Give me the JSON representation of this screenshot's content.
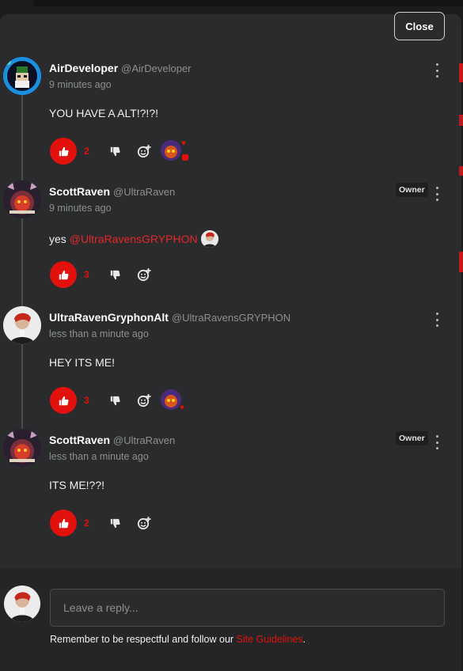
{
  "dialog": {
    "close_label": "Close"
  },
  "comments": [
    {
      "author": "AirDeveloper",
      "handle": "@AirDeveloper",
      "time": "9 minutes ago",
      "text": "YOU HAVE A ALT!?!?!",
      "likes": "2",
      "badge": null,
      "mention": null,
      "reactions": [
        "heart",
        "red-square"
      ]
    },
    {
      "author": "ScottRaven",
      "handle": "@UltraRaven",
      "time": "9 minutes ago",
      "text": "yes",
      "mention": "@UltraRavensGRYPHON",
      "likes": "3",
      "badge": "Owner"
    },
    {
      "author": "UltraRavenGryphonAlt",
      "handle": "@UltraRavensGRYPHON",
      "time": "less than a minute ago",
      "text": "HEY ITS ME!",
      "likes": "3",
      "badge": null,
      "reactions": [
        "heart"
      ]
    },
    {
      "author": "ScottRaven",
      "handle": "@UltraRaven",
      "time": "less than a minute ago",
      "text": "ITS ME!??!",
      "likes": "2",
      "badge": "Owner"
    }
  ],
  "reply": {
    "placeholder": "Leave a reply...",
    "guidelines_prefix": "Remember to be respectful and follow our ",
    "guidelines_link": "Site Guidelines",
    "guidelines_suffix": "."
  },
  "colors": {
    "accent": "#e3110d",
    "panel": "#292b2c",
    "background": "#1b1c1d"
  },
  "icons": [
    "kebab-menu-icon",
    "thumbs-up-icon",
    "thumbs-down-icon",
    "add-reaction-icon"
  ]
}
